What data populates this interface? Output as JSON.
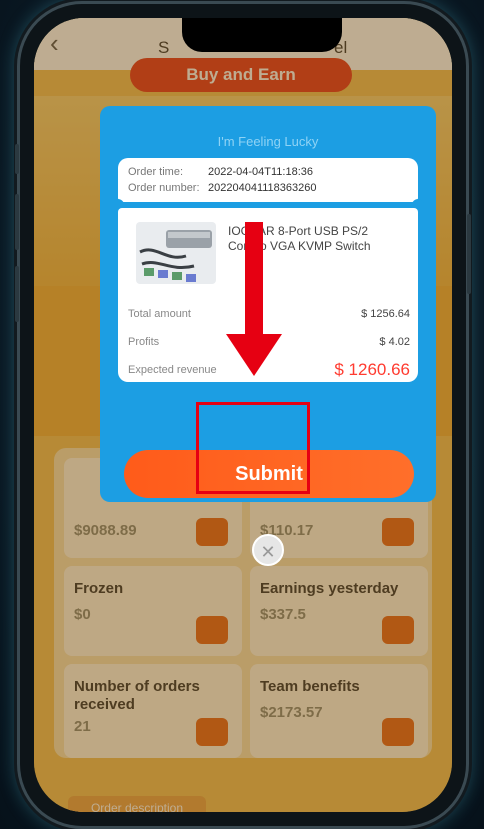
{
  "header": {
    "back_icon": "chevron-left-icon",
    "title_left": "S",
    "title_right": "el"
  },
  "background": {
    "top_button": "Buy and Earn",
    "cards": [
      {
        "label": "",
        "value": "$9088.89",
        "icon": "cart-icon"
      },
      {
        "label": "",
        "value": "$110.17",
        "icon": "lock-icon"
      },
      {
        "label": "Frozen",
        "value": "$0",
        "icon": "bag-icon"
      },
      {
        "label": "Earnings yesterday",
        "value": "$337.5",
        "icon": "wallet-icon"
      },
      {
        "label": "Number of orders received",
        "value": "21",
        "icon": "moneybag-icon"
      },
      {
        "label": "Team benefits",
        "value": "$2173.57",
        "icon": "gift-icon"
      }
    ],
    "bottom_pill": "Order description"
  },
  "modal": {
    "title": "I'm Feeling Lucky",
    "order_time_label": "Order time:",
    "order_time": "2022-04-04T11:18:36",
    "order_number_label": "Order number:",
    "order_number": "202204041118363260",
    "product_name": "IOGEAR 8-Port USB PS/2 Combo VGA KVMP Switch",
    "total_amount_label": "Total amount",
    "total_amount": "$ 1256.64",
    "profits_label": "Profits",
    "profits": "$ 4.02",
    "expected_revenue_label": "Expected revenue",
    "expected_revenue": "$ 1260.66",
    "submit_label": "Submit",
    "close_icon": "close-icon"
  },
  "annotation": {
    "color": "#e60012"
  },
  "colors": {
    "modal_bg": "#1c9ee3",
    "submit": "#ff5b1a",
    "background": "#f2c25a"
  }
}
